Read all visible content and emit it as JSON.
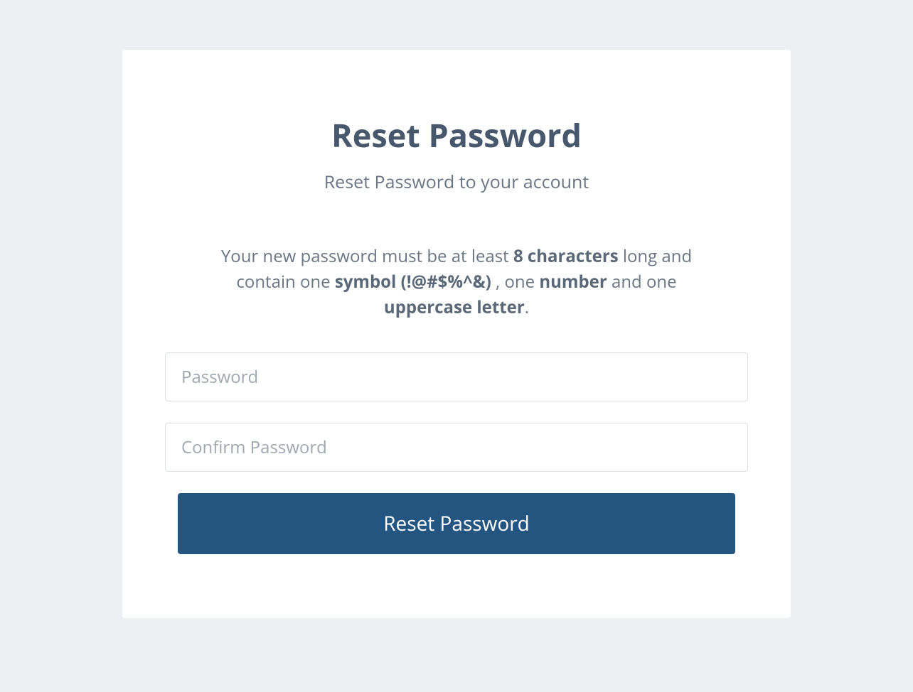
{
  "header": {
    "title": "Reset Password",
    "subtitle": "Reset Password to your account"
  },
  "instructions": {
    "part1": "Your new password must be at least ",
    "bold1": "8 characters",
    "part2": " long and contain one ",
    "bold2": "symbol (!@#$%^&)",
    "part3": " , one ",
    "bold3": "number",
    "part4": " and one ",
    "bold4": "uppercase letter",
    "part5": "."
  },
  "form": {
    "password_placeholder": "Password",
    "confirm_password_placeholder": "Confirm Password",
    "submit_label": "Reset Password"
  }
}
